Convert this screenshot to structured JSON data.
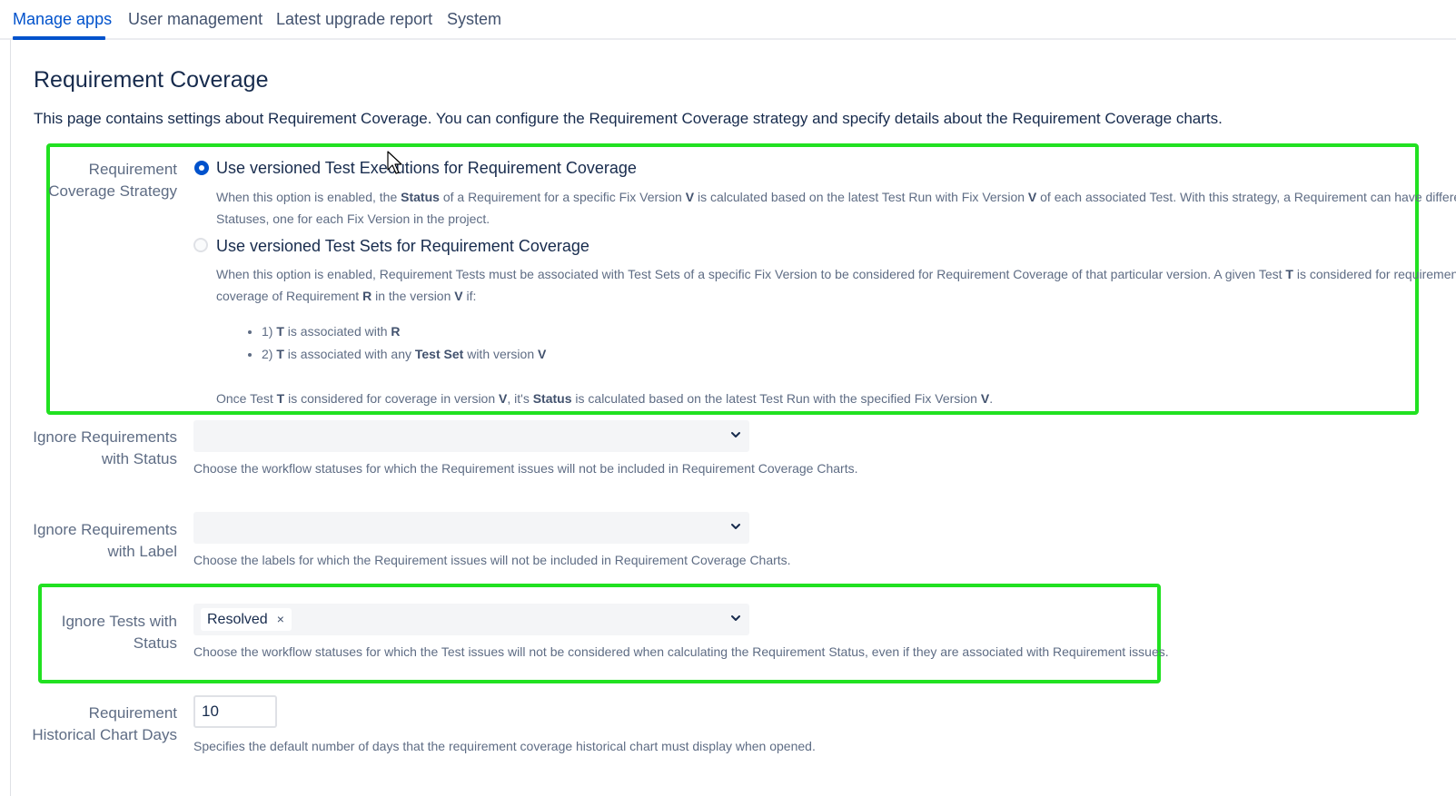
{
  "nav": {
    "tabs": [
      {
        "label": "Manage apps",
        "active": true
      },
      {
        "label": "User management",
        "active": false
      },
      {
        "label": "Latest upgrade report",
        "active": false
      },
      {
        "label": "System",
        "active": false
      }
    ]
  },
  "page": {
    "title": "Requirement Coverage",
    "intro": "This page contains settings about Requirement Coverage. You can configure the Requirement Coverage strategy and specify details about the Requirement Coverage charts."
  },
  "strategy": {
    "label_line1": "Requirement",
    "label_line2": "Coverage Strategy",
    "selected": "versioned-test-executions",
    "options": [
      {
        "label": "Use versioned Test Executions for Requirement Coverage",
        "checked": true,
        "desc_line1": "When this option is enabled, the Status of a Requirement for a specific Fix Version V is calculated based on the latest Test Run with Fix Version V of each associated Test. With this strategy, a Requirement can have different",
        "desc_line2": "Statuses, one for each Fix Version in the project."
      },
      {
        "label": "Use versioned Test Sets for Requirement Coverage",
        "checked": false,
        "desc_line1": "When this option is enabled, Requirement Tests must be associated with Test Sets of a specific Fix Version to be considered for Requirement Coverage of that particular version. A given Test T is considered for requirement",
        "desc_line2": "coverage of Requirement R in the version V if:",
        "bullets": [
          "1) T is associated with R",
          "2) T is associated with any Test Set with version V"
        ],
        "desc_footer": "Once Test T is considered for coverage in version V, it's Status is calculated based on the latest Test Run with the specified Fix Version V."
      }
    ]
  },
  "ignore_req_status": {
    "label_line1": "Ignore Requirements",
    "label_line2": "with Status",
    "help": "Choose the workflow statuses for which the Requirement issues will not be included in Requirement Coverage Charts."
  },
  "ignore_req_label": {
    "label_line1": "Ignore Requirements",
    "label_line2": "with Label",
    "help": "Choose the labels for which the Requirement issues will not be included in Requirement Coverage Charts."
  },
  "ignore_tests_status": {
    "label_line1": "Ignore Tests with",
    "label_line2": "Status",
    "tags": [
      "Resolved"
    ],
    "remove_glyph": "×",
    "help": "Choose the workflow statuses for which the Test issues will not be considered when calculating the Requirement Status, even if they are associated with Requirement issues."
  },
  "historical_days": {
    "label_line1": "Requirement",
    "label_line2": "Historical Chart Days",
    "value": "10",
    "help": "Specifies the default number of days that the requirement coverage historical chart must display when opened."
  },
  "colors": {
    "accent": "#0052cc",
    "highlight": "#21e121",
    "text": "#172b4d",
    "muted": "#5e6c84"
  }
}
